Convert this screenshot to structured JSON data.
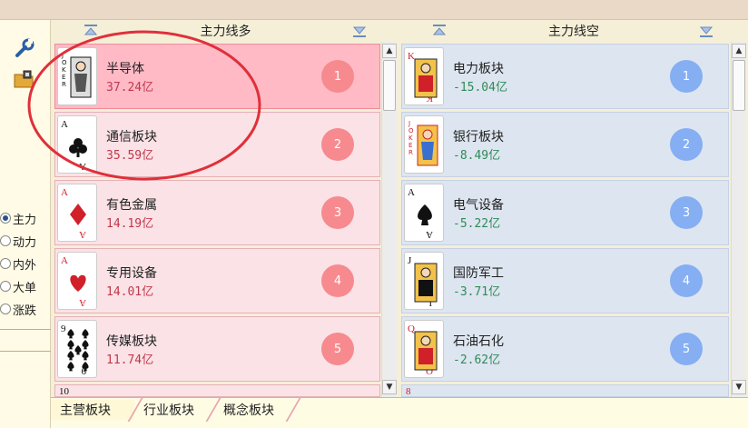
{
  "left_panel": {
    "tool_icons": [
      "wrench-icon",
      "folder-lock-icon"
    ],
    "radio_options": [
      {
        "label": "主力",
        "selected": true
      },
      {
        "label": "动力",
        "selected": false
      },
      {
        "label": "内外",
        "selected": false
      },
      {
        "label": "大单",
        "selected": false
      },
      {
        "label": "涨跌",
        "selected": false
      }
    ]
  },
  "long_column": {
    "title": "主力线多",
    "items": [
      {
        "name": "半导体",
        "value": "37.24亿",
        "rank": "1",
        "card": "joker-black",
        "active": true
      },
      {
        "name": "通信板块",
        "value": "35.59亿",
        "rank": "2",
        "card": "ace-clubs"
      },
      {
        "name": "有色金属",
        "value": "14.19亿",
        "rank": "3",
        "card": "ace-diamonds"
      },
      {
        "name": "专用设备",
        "value": "14.01亿",
        "rank": "4",
        "card": "ace-hearts"
      },
      {
        "name": "传媒板块",
        "value": "11.74亿",
        "rank": "5",
        "card": "nine-spades"
      }
    ],
    "partial_card": "10"
  },
  "short_column": {
    "title": "主力线空",
    "items": [
      {
        "name": "电力板块",
        "value": "-15.04亿",
        "rank": "1",
        "card": "king-diamonds"
      },
      {
        "name": "银行板块",
        "value": "-8.49亿",
        "rank": "2",
        "card": "joker-red"
      },
      {
        "name": "电气设备",
        "value": "-5.22亿",
        "rank": "3",
        "card": "ace-spades"
      },
      {
        "name": "国防军工",
        "value": "-3.71亿",
        "rank": "4",
        "card": "jack-clubs"
      },
      {
        "name": "石油石化",
        "value": "-2.62亿",
        "rank": "5",
        "card": "queen-diamonds"
      }
    ],
    "partial_card": "8"
  },
  "tabs": [
    {
      "label": "主营板块",
      "selected": true
    },
    {
      "label": "行业板块",
      "selected": false
    },
    {
      "label": "概念板块",
      "selected": false
    }
  ],
  "colors": {
    "long_active": "#ffbac6",
    "long_card": "#fbe2e6",
    "short_card": "#dde5f0",
    "long_badge": "#f78a8e",
    "short_badge": "#85aef3",
    "long_value": "#c0384c",
    "short_value": "#2e8b57",
    "annotation": "#e0303a"
  }
}
